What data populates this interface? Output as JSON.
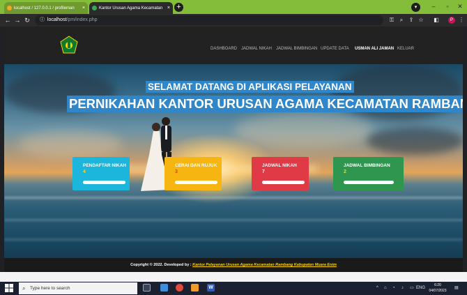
{
  "browser": {
    "tabs": [
      {
        "label": "localhost / 127.0.0.1 / profileman",
        "close": "×"
      },
      {
        "label": "Kantor Urusan Agama Kecamatan",
        "close": "×"
      }
    ],
    "new_tab": "+",
    "address": {
      "host": "localhost",
      "path": "/pm/index.php"
    },
    "profile_letter": "P"
  },
  "site": {
    "menu": [
      "DASHBOARD",
      "JADWAL NIKAH",
      "JADWAL BIMBINGAN",
      "UPDATE DATA",
      "USMAN ALI JAMAN",
      "KELUAR"
    ],
    "hero": {
      "line1": "SELAMAT DATANG DI APLIKASI PELAYANAN",
      "line2": "PERNIKAHAN KANTOR URUSAN AGAMA KECAMATAN RAMBANG"
    },
    "cards": [
      {
        "label": "PENDAFTAR NIKAH",
        "count": "4",
        "color": "#1cb5dc",
        "count_color": "#ffd600"
      },
      {
        "label": "CERAI DAN RUJUK",
        "count": "3",
        "color": "#f7b512",
        "count_color": "#e0362c"
      },
      {
        "label": "JADWAL NIKAH",
        "count": "7",
        "color": "#df3a45",
        "count_color": "#ffffff"
      },
      {
        "label": "JADWAL BIMBINGAN",
        "count": "2",
        "color": "#2f9650",
        "count_color": "#ffd600"
      }
    ],
    "footer": {
      "prefix": "Copyright © 2022. Developed by : ",
      "link": "Kantor Pelayanan Urusan Agama Kecamatan Rambang Kabupaten Muara Enim"
    }
  },
  "taskbar": {
    "search_placeholder": "Type here to search",
    "language": "ENG",
    "time": "6:20",
    "date": "04/07/2023"
  }
}
